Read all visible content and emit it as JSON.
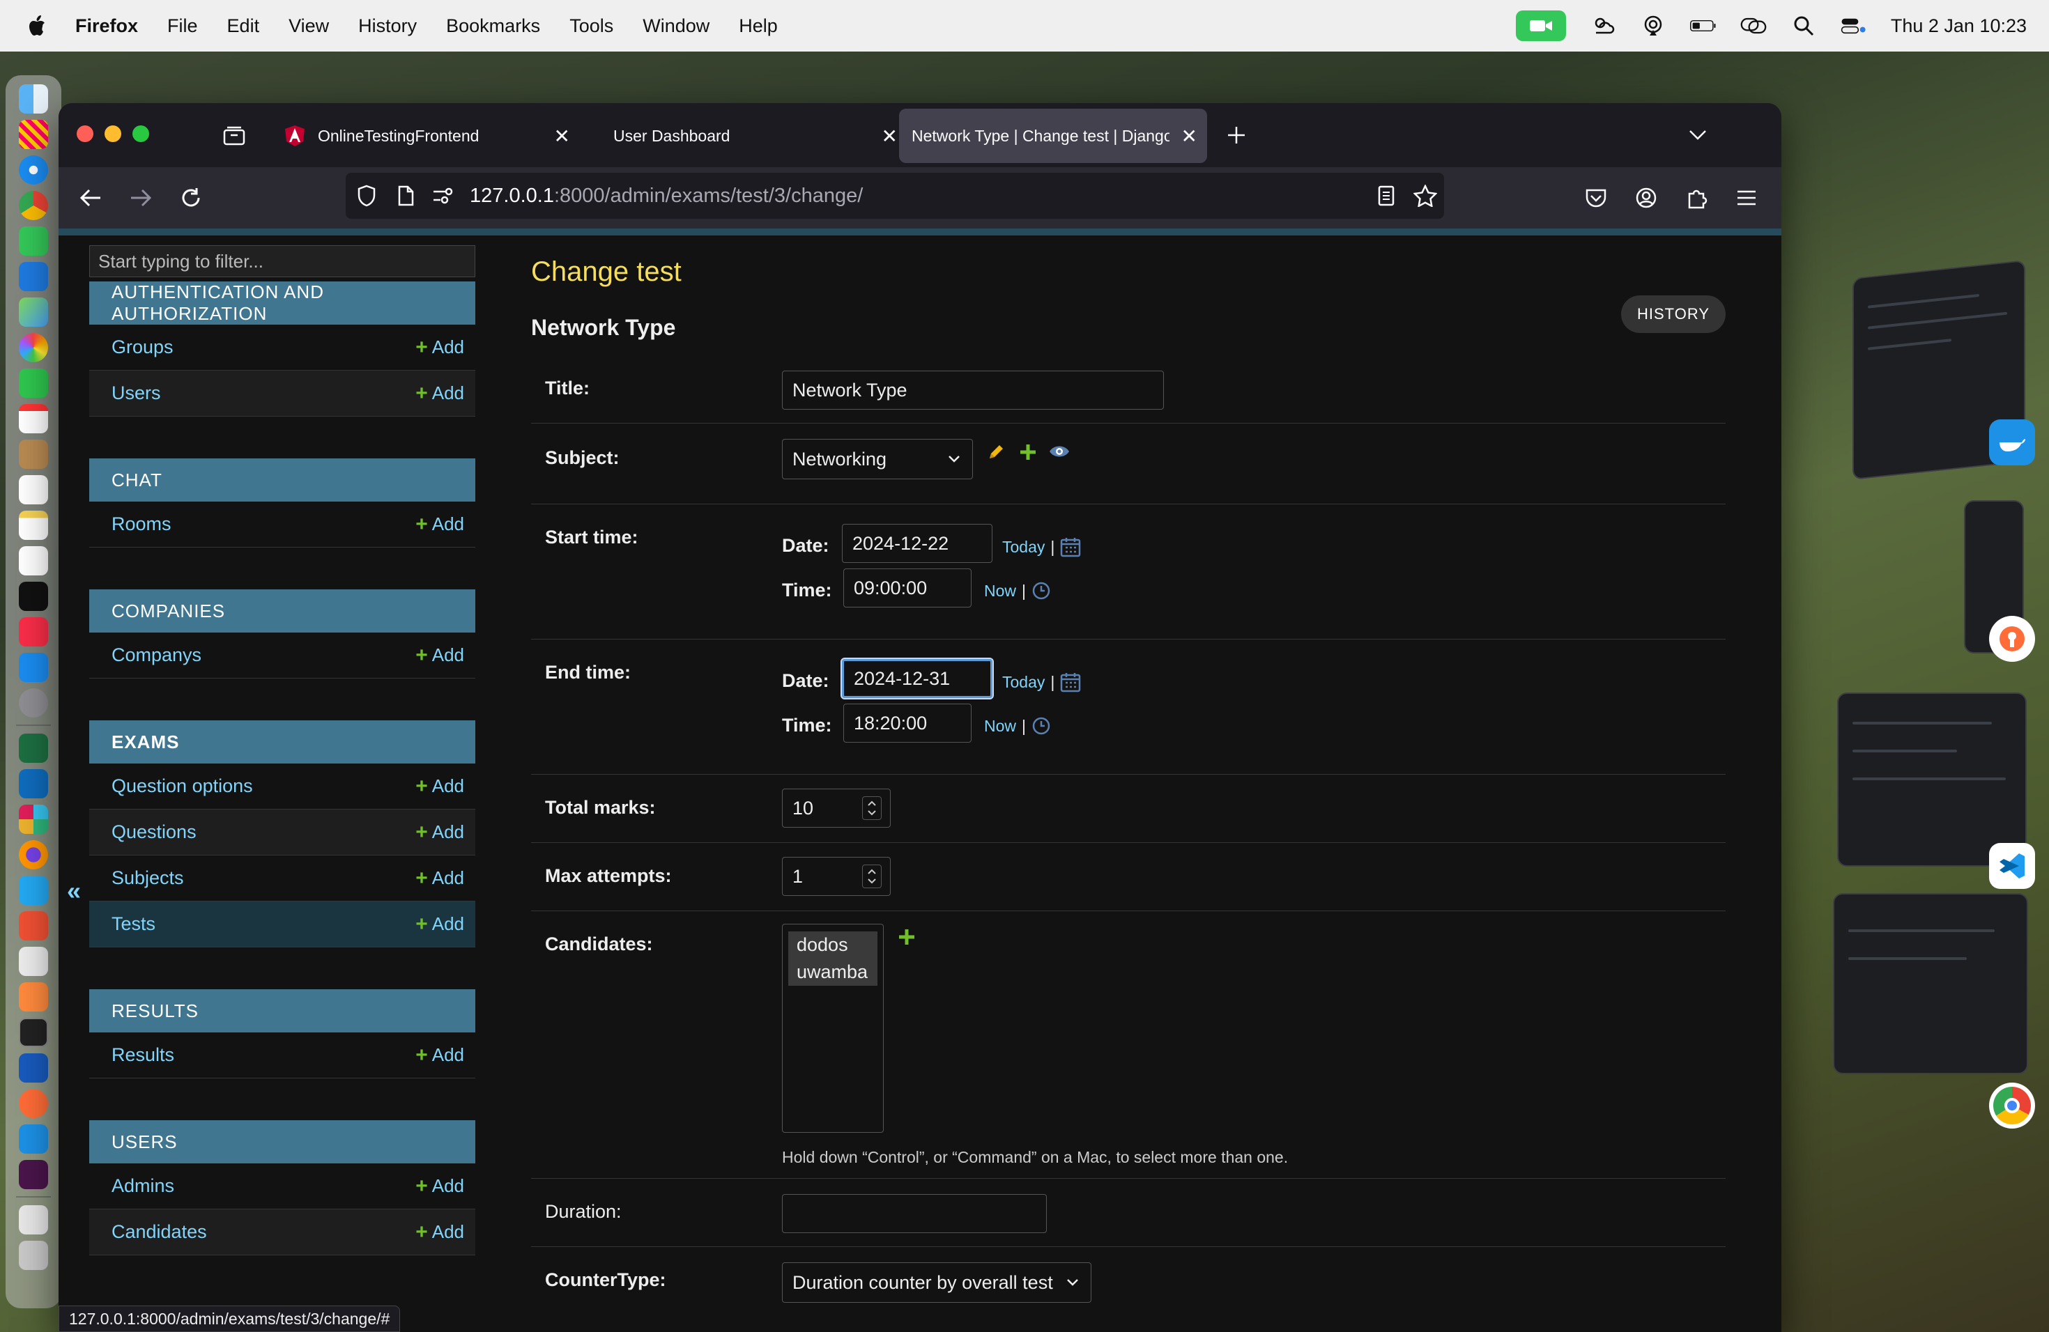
{
  "menubar": {
    "app_name": "Firefox",
    "items": [
      "File",
      "Edit",
      "View",
      "History",
      "Bookmarks",
      "Tools",
      "Window",
      "Help"
    ],
    "clock": "Thu 2 Jan  10:23"
  },
  "browser": {
    "tabs": [
      {
        "title": "OnlineTestingFrontend",
        "active": false
      },
      {
        "title": "User Dashboard",
        "active": false
      },
      {
        "title": "Network Type | Change test | Django",
        "active": true
      }
    ],
    "url_host": "127.0.0.1",
    "url_path": ":8000/admin/exams/test/3/change/",
    "status_url": "127.0.0.1:8000/admin/exams/test/3/change/#"
  },
  "sidebar": {
    "filter_placeholder": "Start typing to filter...",
    "add_label": "Add",
    "collapse_glyph": "«",
    "modules": [
      {
        "caption": "AUTHENTICATION AND AUTHORIZATION",
        "models": [
          "Groups",
          "Users"
        ]
      },
      {
        "caption": "CHAT",
        "models": [
          "Rooms"
        ]
      },
      {
        "caption": "COMPANIES",
        "models": [
          "Companys"
        ]
      },
      {
        "caption": "EXAMS",
        "models": [
          "Question options",
          "Questions",
          "Subjects",
          "Tests"
        ],
        "current_model": "Tests"
      },
      {
        "caption": "RESULTS",
        "models": [
          "Results"
        ]
      },
      {
        "caption": "USERS",
        "models": [
          "Admins",
          "Candidates"
        ]
      }
    ]
  },
  "main": {
    "title": "Change test",
    "history_label": "HISTORY",
    "fieldset_title": "Network Type",
    "fields": {
      "title": {
        "label": "Title:",
        "value": "Network Type"
      },
      "subject": {
        "label": "Subject:",
        "value": "Networking"
      },
      "start_time": {
        "label": "Start time:",
        "date_label": "Date:",
        "date": "2024-12-22",
        "time_label": "Time:",
        "time": "09:00:00",
        "today": "Today",
        "now": "Now"
      },
      "end_time": {
        "label": "End time:",
        "date_label": "Date:",
        "date": "2024-12-31",
        "time_label": "Time:",
        "time": "18:20:00",
        "today": "Today",
        "now": "Now"
      },
      "total_marks": {
        "label": "Total marks:",
        "value": "10"
      },
      "max_attempts": {
        "label": "Max attempts:",
        "value": "1"
      },
      "candidates": {
        "label": "Candidates:",
        "options": [
          "dodos",
          "uwamba"
        ],
        "help": "Hold down “Control”, or “Command” on a Mac, to select more than one."
      },
      "duration": {
        "label": "Duration:",
        "value": ""
      },
      "counter_type": {
        "label": "CounterType:",
        "value": "Duration counter by overall test"
      }
    }
  },
  "colors": {
    "module_header": "#417690",
    "link": "#81d4fa",
    "add_plus": "#70bf2b",
    "title_yellow": "#f5dd5d",
    "focus": "#5b9bd5"
  }
}
